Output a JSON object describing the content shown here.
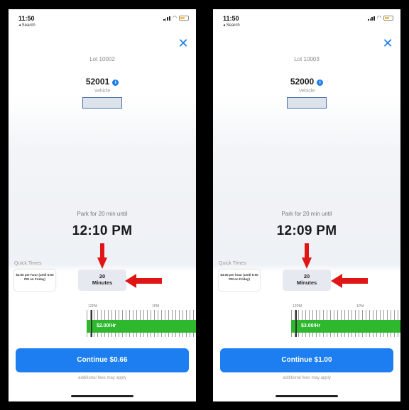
{
  "colors": {
    "accent": "#1c7ef0",
    "rate_bar": "#2eb82e",
    "annotation_arrow": "#e01515"
  },
  "screens": [
    {
      "status_time": "11:50",
      "back_label": "◂ Search",
      "close_icon": "close-icon",
      "lot": "Lot 10002",
      "vehicle_number": "52001",
      "vehicle_label": "Vehicle",
      "park_for": "Park for 20 min until",
      "until_time": "12:10 PM",
      "quick_times_label": "Quick Times",
      "rate_card": "$2.00 per hour (until 5:00 PM on Friday)",
      "minutes_value": "20",
      "minutes_unit": "Minutes",
      "timeline_ticks": [
        "12PM",
        "1PM"
      ],
      "rate_bar_label": "$2.00/Hr",
      "continue_label": "Continue $0.66",
      "fees_note": "additional fees may apply"
    },
    {
      "status_time": "11:50",
      "back_label": "◂ Search",
      "close_icon": "close-icon",
      "lot": "Lot 10003",
      "vehicle_number": "52000",
      "vehicle_label": "Vehicle",
      "park_for": "Park for 20 min until",
      "until_time": "12:09 PM",
      "quick_times_label": "Quick Times",
      "rate_card": "$3.00 per hour (until 5:00 PM on Friday)",
      "minutes_value": "20",
      "minutes_unit": "Minutes",
      "timeline_ticks": [
        "12PM",
        "1PM"
      ],
      "rate_bar_label": "$3.00/Hr",
      "continue_label": "Continue $1.00",
      "fees_note": "additional fees may apply"
    }
  ]
}
